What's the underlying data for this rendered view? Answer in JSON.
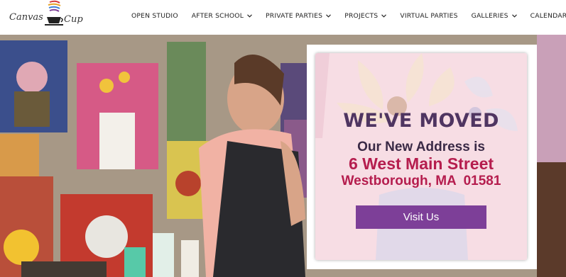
{
  "logo": {
    "text_left": "Canvas",
    "text_right": "Cup",
    "icon": "teacup-icon"
  },
  "nav": {
    "items": [
      {
        "label": "OPEN STUDIO",
        "dropdown": false
      },
      {
        "label": "AFTER SCHOOL",
        "dropdown": true
      },
      {
        "label": "PRIVATE PARTIES",
        "dropdown": true
      },
      {
        "label": "PROJECTS",
        "dropdown": true
      },
      {
        "label": "VIRTUAL PARTIES",
        "dropdown": false
      },
      {
        "label": "GALLERIES",
        "dropdown": true
      },
      {
        "label": "CALENDAR",
        "dropdown": false
      }
    ]
  },
  "popup": {
    "title": "WE'VE MOVED",
    "subtitle": "Our New Address is",
    "street": "6 West Main Street",
    "city": "Westborough, MA  01581",
    "button_label": "Visit Us"
  },
  "colors": {
    "title": "#4f3561",
    "address": "#b51d4e",
    "button": "#7d3f98"
  }
}
